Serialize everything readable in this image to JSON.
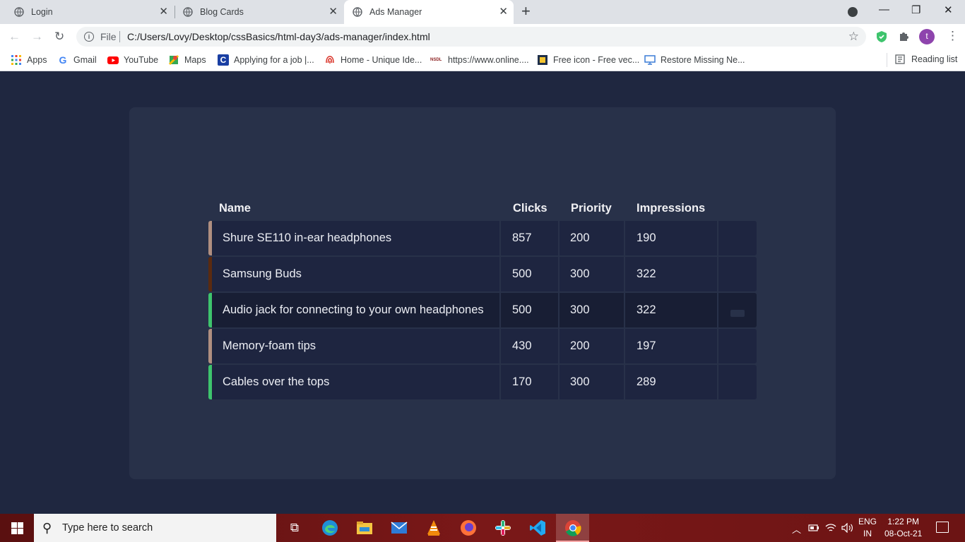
{
  "browser": {
    "tabs": [
      {
        "title": "Login"
      },
      {
        "title": "Blog Cards"
      },
      {
        "title": "Ads Manager"
      }
    ],
    "new_tab": "+",
    "omnibox": {
      "scheme": "File",
      "url": "C:/Users/Lovy/Desktop/cssBasics/html-day3/ads-manager/index.html"
    },
    "profile_initial": "t",
    "bookmarks": [
      {
        "label": "Apps",
        "icon": "apps-grid-icon",
        "color": "#4285f4"
      },
      {
        "label": "Gmail",
        "icon": "google-icon",
        "color": "#ea4335"
      },
      {
        "label": "YouTube",
        "icon": "youtube-icon",
        "color": "#ff0000"
      },
      {
        "label": "Maps",
        "icon": "maps-icon",
        "color": "#34a853"
      },
      {
        "label": "Applying for a job |...",
        "icon": "c-logo-icon",
        "color": "#1a3fa3"
      },
      {
        "label": "Home - Unique Ide...",
        "icon": "fingerprint-icon",
        "color": "#d93025"
      },
      {
        "label": "https://www.online....",
        "icon": "nsdl-icon",
        "color": "#8a1c1c"
      },
      {
        "label": "Free icon - Free vec...",
        "icon": "freepik-icon",
        "color": "#1f2f4a"
      },
      {
        "label": "Restore Missing Ne...",
        "icon": "monitor-icon",
        "color": "#3a7bd5"
      }
    ],
    "reading_list": "Reading list"
  },
  "table": {
    "headers": {
      "name": "Name",
      "clicks": "Clicks",
      "priority": "Priority",
      "impressions": "Impressions"
    },
    "rows": [
      {
        "name": "Shure SE110 in-ear headphones",
        "clicks": "857",
        "priority": "200",
        "impressions": "190",
        "accent": "#b08f80"
      },
      {
        "name": "Samsung Buds",
        "clicks": "500",
        "priority": "300",
        "impressions": "322",
        "accent": "#5a2a10"
      },
      {
        "name": "Audio jack for connecting to your own headphones",
        "clicks": "500",
        "priority": "300",
        "impressions": "322",
        "accent": "#3ec46d"
      },
      {
        "name": "Memory-foam tips",
        "clicks": "430",
        "priority": "200",
        "impressions": "197",
        "accent": "#b08f80"
      },
      {
        "name": "Cables over the tops",
        "clicks": "170",
        "priority": "300",
        "impressions": "289",
        "accent": "#3ec46d"
      }
    ]
  },
  "taskbar": {
    "search_placeholder": "Type here to search",
    "lang": "ENG",
    "region": "IN",
    "time": "1:22 PM",
    "date": "08-Oct-21"
  }
}
